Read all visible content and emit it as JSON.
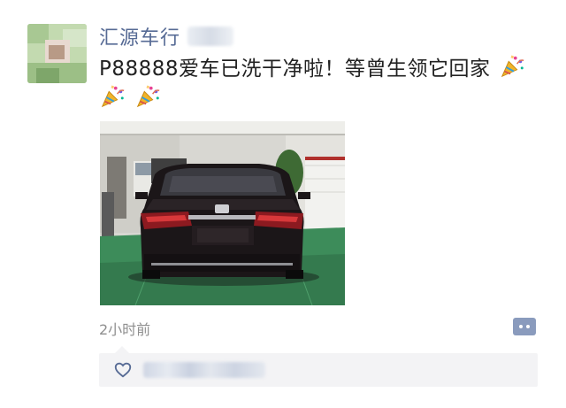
{
  "post": {
    "author": "汇源车行",
    "text": "P88888爱车已洗干净啦！等曾生领它回家",
    "time_ago": "2小时前"
  },
  "icons": {
    "avatar": "blurred-avatar",
    "emoji": "party-popper-icon",
    "more": "comment-dots-icon",
    "like": "heart-outline-icon"
  },
  "colors": {
    "author_name": "#576b95",
    "body_text": "#222222",
    "timestamp": "#8f8f8f",
    "like_panel": "#f3f3f5",
    "more_button": "#8a9bbd"
  }
}
